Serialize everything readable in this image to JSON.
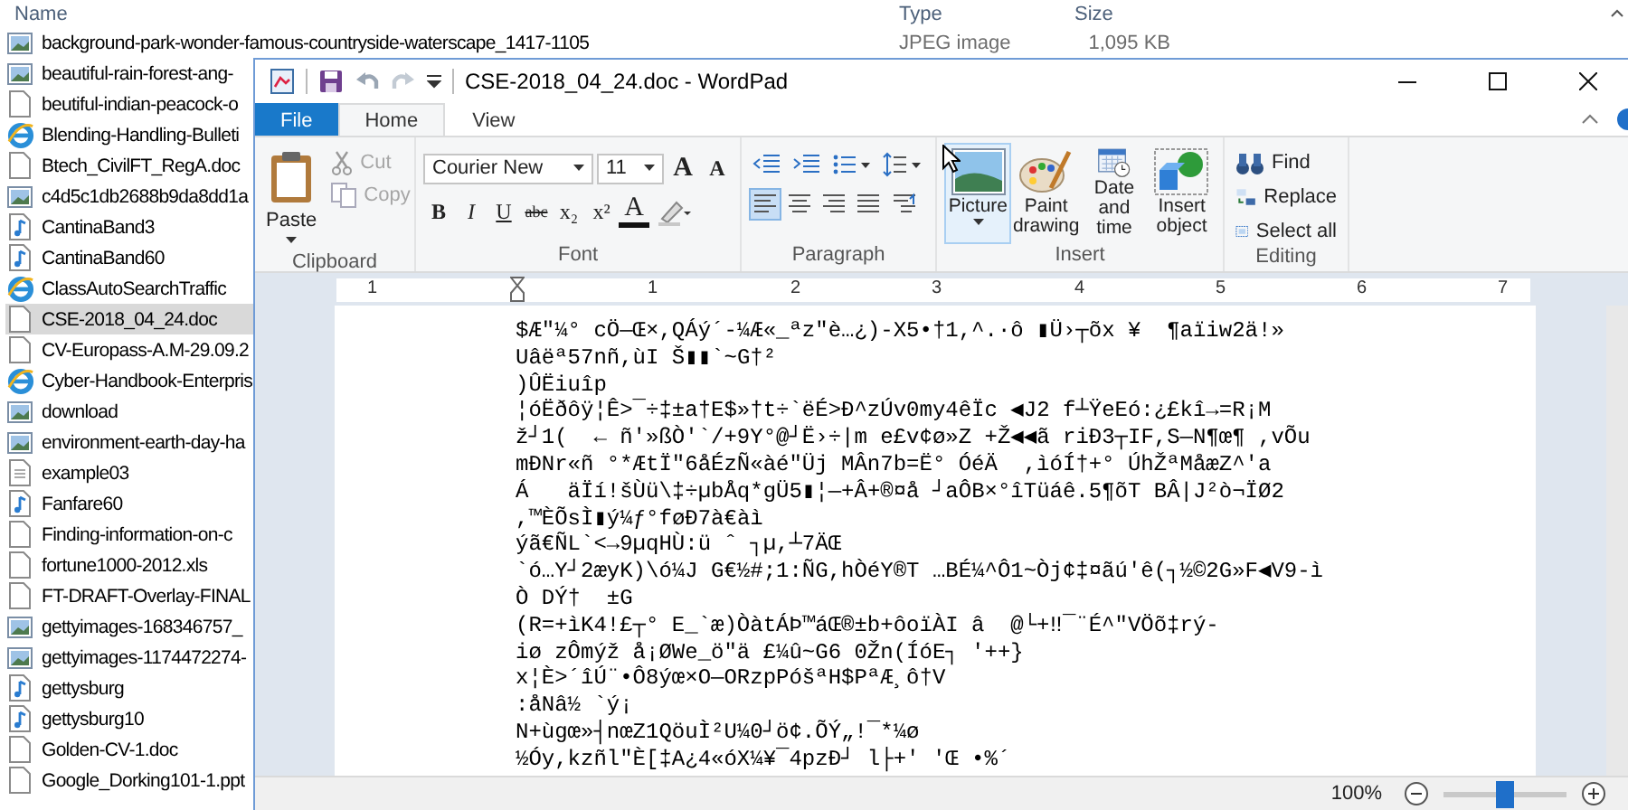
{
  "explorer": {
    "columns": [
      "Name",
      "Type",
      "Size"
    ],
    "files": [
      {
        "name": "background-park-wonder-famous-countryside-waterscape_1417-1105",
        "kind": "image",
        "selected": false,
        "type": "JPEG image",
        "size": "1,095 KB"
      },
      {
        "name": "beautiful-rain-forest-ang-",
        "kind": "image",
        "selected": false
      },
      {
        "name": "beutiful-indian-peacock-o",
        "kind": "doc",
        "selected": false
      },
      {
        "name": "Blending-Handling-Bulleti",
        "kind": "web",
        "selected": false
      },
      {
        "name": "Btech_CivilFT_RegA.doc",
        "kind": "doc",
        "selected": false
      },
      {
        "name": "c4d5c1db2688b9da8dd1a",
        "kind": "image",
        "selected": false
      },
      {
        "name": "CantinaBand3",
        "kind": "audio",
        "selected": false
      },
      {
        "name": "CantinaBand60",
        "kind": "audio",
        "selected": false
      },
      {
        "name": "ClassAutoSearchTraffic",
        "kind": "web",
        "selected": false
      },
      {
        "name": "CSE-2018_04_24.doc",
        "kind": "doc",
        "selected": true
      },
      {
        "name": "CV-Europass-A.M-29.09.2",
        "kind": "doc",
        "selected": false
      },
      {
        "name": "Cyber-Handbook-Enterpris",
        "kind": "web",
        "selected": false
      },
      {
        "name": "download",
        "kind": "image",
        "selected": false
      },
      {
        "name": "environment-earth-day-ha",
        "kind": "image",
        "selected": false
      },
      {
        "name": "example03",
        "kind": "text",
        "selected": false
      },
      {
        "name": "Fanfare60",
        "kind": "audio",
        "selected": false
      },
      {
        "name": "Finding-information-on-c",
        "kind": "doc",
        "selected": false
      },
      {
        "name": "fortune1000-2012.xls",
        "kind": "doc",
        "selected": false
      },
      {
        "name": "FT-DRAFT-Overlay-FINAL",
        "kind": "doc",
        "selected": false
      },
      {
        "name": "gettyimages-168346757_",
        "kind": "image",
        "selected": false
      },
      {
        "name": "gettyimages-1174472274-",
        "kind": "image",
        "selected": false
      },
      {
        "name": "gettysburg",
        "kind": "audio",
        "selected": false
      },
      {
        "name": "gettysburg10",
        "kind": "audio",
        "selected": false
      },
      {
        "name": "Golden-CV-1.doc",
        "kind": "doc",
        "selected": false
      },
      {
        "name": "Google_Dorking101-1.ppt",
        "kind": "doc",
        "selected": false
      }
    ]
  },
  "wordpad": {
    "title": "CSE-2018_04_24.doc - WordPad",
    "tabs": [
      {
        "label": "File",
        "kind": "menu",
        "selected": false
      },
      {
        "label": "Home",
        "kind": "tab",
        "selected": true
      },
      {
        "label": "View",
        "kind": "tab",
        "selected": false
      }
    ],
    "clipboard": {
      "label": "Clipboard",
      "paste": "Paste",
      "cut": {
        "label": "Cut",
        "disabled": true
      },
      "copy": {
        "label": "Copy",
        "disabled": true
      }
    },
    "font": {
      "label": "Font",
      "font_name": "Courier New",
      "font_size": "11",
      "grow": "A",
      "shrink": "A",
      "styles": [
        "B",
        "I",
        "U",
        "abc",
        "x₂",
        "x²"
      ],
      "color_letter": "A"
    },
    "paragraph": {
      "label": "Paragraph",
      "alignments": [
        {
          "kind": "left",
          "selected": true
        },
        {
          "kind": "center",
          "selected": false
        },
        {
          "kind": "right",
          "selected": false
        },
        {
          "kind": "justify",
          "selected": false
        }
      ]
    },
    "insert": {
      "label": "Insert",
      "items": [
        {
          "label": "Picture",
          "kind": "picture",
          "dropdown": true
        },
        {
          "label": "Paint drawing",
          "kind": "paint",
          "dropdown": false
        },
        {
          "label": "Date and time",
          "kind": "datetime",
          "dropdown": false
        },
        {
          "label": "Insert object",
          "kind": "object",
          "dropdown": false
        }
      ]
    },
    "editing": {
      "label": "Editing",
      "items": [
        {
          "label": "Find",
          "kind": "find"
        },
        {
          "label": "Replace",
          "kind": "replace"
        },
        {
          "label": "Select all",
          "kind": "selectall"
        }
      ]
    },
    "ruler_labels": [
      "1",
      "1",
      "2",
      "3",
      "4",
      "5",
      "6",
      "7"
    ],
    "document": {
      "lines": [
        "$Æ\"¼° cÖ—Œ×,QÁý´-¼Æ«_ªz\"è…¿)-X5•†1,^.·ô ▮Ü›┬õx ¥  ¶aïiw2ä!»",
        "Uâëª57nñ,ùI Š▮▮`~G†²",
        ")ÛËiuîp",
        "¦óËðôÿ¦Ê>¯÷‡±a†E$»†t÷`ëÉ>Ð^zÚv0my4êÏc ◀J2 f┴ŸeEó:¿£kî→=R¡M",
        "ž┘1(  ← ñ'»ßÒ'`/+9Y°@┘Ë›÷|m e£v¢ø»Z +Ž◀◀ã riÐ3┬IF,S—N¶œ¶ ,vÕu",
        "mÐNr«ñ °*ÆtÏ\"6åÉzÑ«àé\"Üj MÂn7b=Ë° ÓéÄ  ,ìóÍ†+° ÚhŽªMåæZ^'a",
        "Á   äÏí!šÙü\\‡÷µbÅq*gÜ5▮¦—+Â+®¤å ┘aÔB×°îTüáê.5¶õT BÂ|J²ò¬ÏØ2",
        ",™ÈÕsÌ▮ý¼ƒ°føÐ7à€àì",
        "ýã€ÑL`<→9µqHÙ:ü ˆ ┐µ,┴7ÄŒ",
        "`ó…Y┘2æyK)\\ó¼J G€½#;1:ÑG,hÒéY®T …BÉ¼^Ô1~Òj¢‡¤ãú'ê(┐½©2G»F◀V9-ì",
        "Ò DÝ†  ±G",
        "(R=+ìK4!£┬° E_`æ)ÒàtÁÞ™áŒ®±b+ôoïÀI â  @└+‼¯¨É^\"VÖõ‡rý-",
        "iø zÔmýž å¡ØWe_ö\"ä £¼û~G6 0Žn(ÍóE┐ '++}",
        "x¦È>´îÚ¨•Ô8ýœ×O—ORzpPóšªH$PªÆ¸ô†V",
        ":åNâ½ `ý¡",
        "N+ùgœ»┤nœZ1QöuÌ²U¼0┘ö¢.ÕÝ„!¯*¼ø",
        "½Óy,kzñl\"È[‡A¿4«óX¼¥¯4pzÐ┘ l├+' 'Œ •%´"
      ]
    },
    "status_bar": {
      "zoom": "100%",
      "zoom_slider": {
        "level": 0.5
      }
    }
  }
}
